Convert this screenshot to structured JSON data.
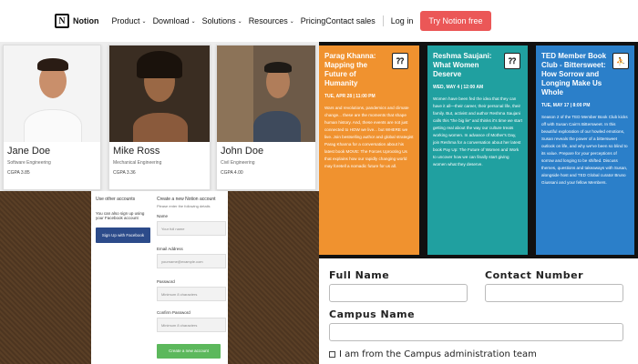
{
  "nav": {
    "brand": "Notion",
    "items": [
      "Product",
      "Download",
      "Solutions",
      "Resources"
    ],
    "pricing": "Pricing",
    "contact": "Contact sales",
    "login": "Log in",
    "cta": "Try Notion free"
  },
  "profiles": [
    {
      "name": "Jane Doe",
      "major": "Software Engineering",
      "gpa": "CGPA 3.85"
    },
    {
      "name": "Mike Ross",
      "major": "Mechanical Engineering",
      "gpa": "CGPA 3.36"
    },
    {
      "name": "John Doe",
      "major": "Civil Engineering",
      "gpa": "CGPA 4.00"
    }
  ],
  "signup": {
    "left_label": "Use other accounts",
    "left_text": "You can also sign up using your Facebook account",
    "facebook_button": "Sign Up with Facebook",
    "title": "Create a new Notion account",
    "subtitle": "Please enter the following details",
    "name_label": "Name",
    "name_placeholder": "Your full name",
    "email_label": "Email Address",
    "email_placeholder": "yourname@example.com",
    "password_label": "Password",
    "password_placeholder": "Minimum 8 characters",
    "confirm_label": "Confirm Password",
    "confirm_placeholder": "Minimum 8 characters",
    "submit": "Create a new account"
  },
  "ted": [
    {
      "title": "Parag Khanna: Mapping the Future of Humanity",
      "date": "TUE, APR 28 | 11:00 PM",
      "desc": "Wars and revolutions, pandemics and climate change... these are the moments that shape human history. And, these events are not just connected to HOW we live... but WHERE we live. Join bestselling author and global strategist Parag Khanna for a conversation about his latest book MOVE: The Forces Uprooting Us that explains how our rapidly changing world may foretell a nomadic future for us all.",
      "color": "#f0922f"
    },
    {
      "title": "Reshma Saujani: What Women Deserve",
      "date": "WED, MAY 4 | 12:00 AM",
      "desc": "Women have been fed the idea that they can have it all—their career, their personal life, their family. But, activist and author Reshma Saujani calls this “the big lie” and thinks it's time we start getting real about the way our culture treats working women. In advance of Mother's Day, join Reshma for a conversation about her latest book Pay Up: The Future of Women and Work to uncover how we can finally start giving women what they deserve.",
      "color": "#20a0a0"
    },
    {
      "title": "TED Member Book Club - Bittersweet: How Sorrow and Longing Make Us Whole",
      "date": "TUE, MAY 17 | 8:00 PM",
      "desc": "Season 2 of the TED Member Book Club kicks off with Susan Cain's Bittersweet. In this beautiful exploration of our howled emotions, Susan reveals the power of a bittersweet outlook on life, and why we've been so blind to its value. Prepare for your perceptions of sorrow and longing to be shifted. Discuss themes, questions and takeaways with Susan, alongside host and TED Global curator Bruno Giussani and your fellow Members.",
      "color": "#2b7fc9"
    }
  ],
  "campus": {
    "full_name": "Full Name",
    "contact_number": "Contact Number",
    "campus_name": "Campus Name",
    "checkbox_label": "I am from the Campus administration team"
  }
}
